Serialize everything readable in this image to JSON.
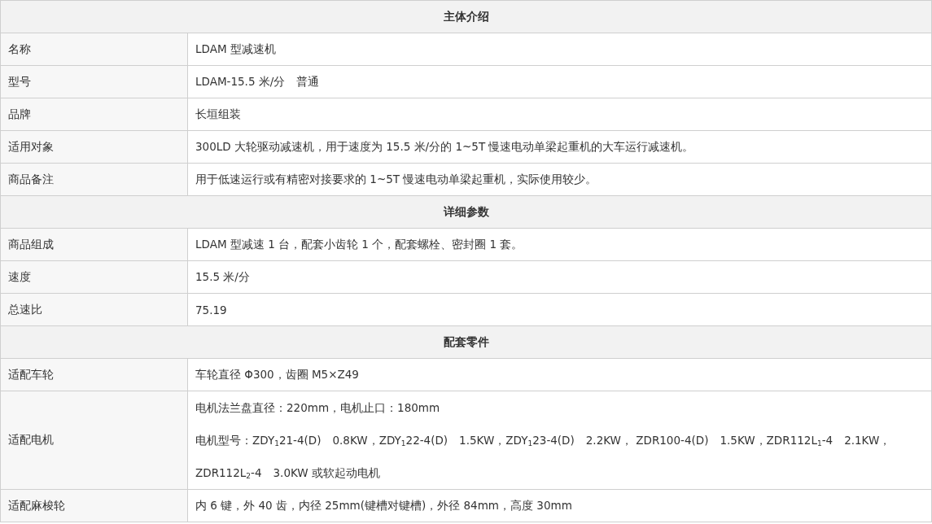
{
  "sections": [
    {
      "title": "主体介绍",
      "rows": [
        {
          "label": "名称",
          "lines": [
            "LDAM 型减速机"
          ]
        },
        {
          "label": "型号",
          "lines": [
            "LDAM-15.5 米/分　普通"
          ]
        },
        {
          "label": "品牌",
          "lines": [
            "长垣组装"
          ]
        },
        {
          "label": "适用对象",
          "lines": [
            "300LD 大轮驱动减速机，用于速度为 15.5 米/分的 1~5T 慢速电动单梁起重机的大车运行减速机。"
          ]
        },
        {
          "label": "商品备注",
          "lines": [
            "用于低速运行或有精密对接要求的 1~5T 慢速电动单梁起重机，实际使用较少。"
          ]
        }
      ]
    },
    {
      "title": "详细参数",
      "rows": [
        {
          "label": "商品组成",
          "lines": [
            "LDAM 型减速 1 台，配套小齿轮 1 个，配套螺栓、密封圈 1 套。"
          ]
        },
        {
          "label": "速度",
          "lines": [
            "15.5 米/分"
          ]
        },
        {
          "label": "总速比",
          "lines": [
            "75.19"
          ]
        }
      ]
    },
    {
      "title": "配套零件",
      "rows": [
        {
          "label": "适配车轮",
          "lines": [
            "车轮直径 Φ300，齿圈 M5×Z49"
          ]
        },
        {
          "label": "适配电机",
          "lines": [
            "电机法兰盘直径：220mm，电机止口：180mm",
            "电机型号：ZDY$_{1}$21-4(D)　0.8KW，ZDY$_{1}$22-4(D)　1.5KW，ZDY$_{1}$23-4(D)　2.2KW，  ZDR100-4(D)　1.5KW，ZDR112L$_{1}$-4　2.1KW，ZDR112L$_{2}$-4　3.0KW 或软起动电机"
          ]
        },
        {
          "label": "适配麻梭轮",
          "lines": [
            "内 6 键，外 40 齿，内径 25mm(键槽对键槽)，外径 84mm，高度 30mm"
          ]
        }
      ]
    }
  ]
}
